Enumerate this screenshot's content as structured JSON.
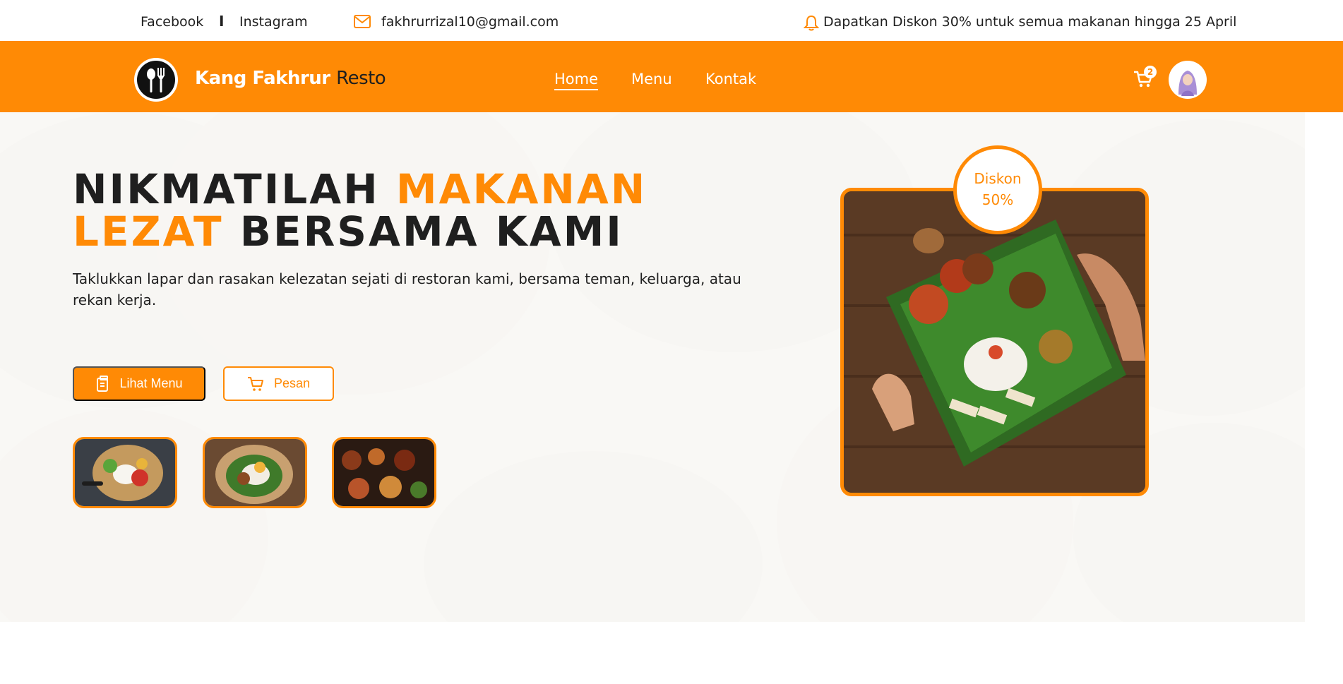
{
  "topbar": {
    "facebook": "Facebook",
    "separator": "I",
    "instagram": "Instagram",
    "email": "fakhrurrizal10@gmail.com",
    "promo": "Dapatkan Diskon 30% untuk semua makanan hingga 25 April"
  },
  "nav": {
    "brand_first": "Kang Fakhrur",
    "brand_second": "Resto",
    "items": [
      {
        "label": "Home"
      },
      {
        "label": "Menu"
      },
      {
        "label": "Kontak"
      }
    ],
    "cart_count": "2"
  },
  "hero": {
    "headline_1": "NIKMATILAH",
    "headline_2": "MAKANAN",
    "headline_3": "LEZAT",
    "headline_4": "BERSAMA KAMI",
    "subtitle": "Taklukkan lapar dan rasakan kelezatan sejati di restoran kami, bersama teman, keluarga, atau rekan kerja.",
    "btn_menu": "Lihat Menu",
    "btn_order": "Pesan",
    "badge_line1": "Diskon",
    "badge_line2": "50%"
  },
  "colors": {
    "accent": "#ff8a05",
    "dark": "#1f1f1f",
    "white": "#ffffff"
  }
}
